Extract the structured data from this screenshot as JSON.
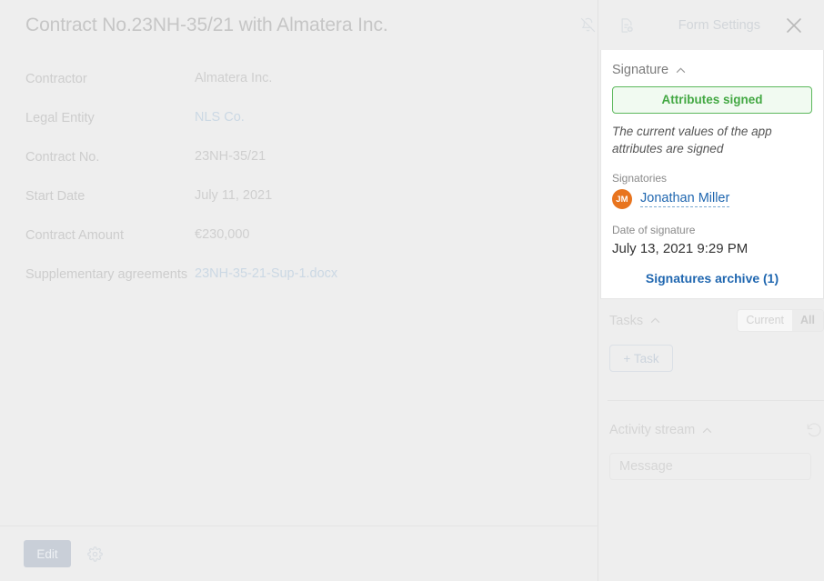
{
  "header": {
    "title": "Contract No.23NH-35/21 with Almatera Inc.",
    "form_settings_label": "Form Settings",
    "notifications_off_icon": "bell-off-icon",
    "document_settings_icon": "document-settings-icon",
    "close_icon": "close-icon"
  },
  "fields": [
    {
      "label": "Contractor",
      "value": "Almatera Inc.",
      "is_link": false
    },
    {
      "label": "Legal Entity",
      "value": "NLS Co.",
      "is_link": true
    },
    {
      "label": "Contract No.",
      "value": "23NH-35/21",
      "is_link": false
    },
    {
      "label": "Start Date",
      "value": "July 11, 2021",
      "is_link": false
    },
    {
      "label": "Contract Amount",
      "value": "€230,000",
      "is_link": false
    },
    {
      "label": "Supplementary agreements",
      "value": "23NH-35-21-Sup-1.docx",
      "is_link": true
    }
  ],
  "footer": {
    "edit_label": "Edit",
    "settings_icon": "gear-icon"
  },
  "signature": {
    "section_title": "Signature",
    "collapse_icon": "chevron-up-icon",
    "badge_label": "Attributes signed",
    "description": "The current values of the app attributes are signed",
    "signatories_label": "Signatories",
    "signatory": {
      "initials": "JM",
      "name": "Jonathan Miller"
    },
    "date_label": "Date of signature",
    "date_value": "July 13, 2021 9:29 PM",
    "archive_link": "Signatures archive (1)"
  },
  "tasks": {
    "section_title": "Tasks",
    "collapse_icon": "chevron-up-icon",
    "filter_current": "Current",
    "filter_all": "All",
    "add_task_label": "+ Task"
  },
  "activity": {
    "section_title": "Activity stream",
    "collapse_icon": "chevron-up-icon",
    "refresh_icon": "history-refresh-icon",
    "message_placeholder": "Message"
  },
  "colors": {
    "page_background": "#eeeeee",
    "signed_border": "#5cb85c",
    "signed_text": "#43a843",
    "signed_fill": "#f1faf1",
    "avatar": "#e8741e",
    "link": "#2067b0",
    "muted_text": "#cdcdcd"
  }
}
